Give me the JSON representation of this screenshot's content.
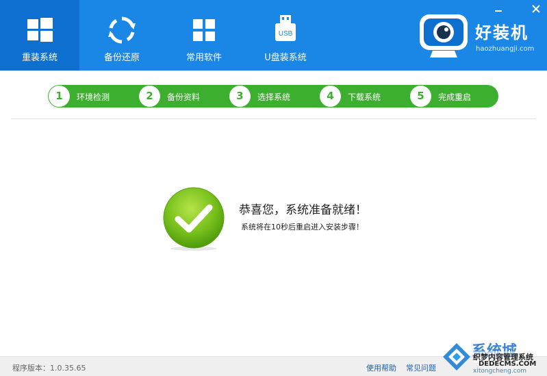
{
  "header": {
    "nav": [
      {
        "label": "重装系统",
        "icon": "windows-icon",
        "active": true
      },
      {
        "label": "备份还原",
        "icon": "sync-icon",
        "active": false
      },
      {
        "label": "常用软件",
        "icon": "apps-grid-icon",
        "active": false
      },
      {
        "label": "U盘装系统",
        "icon": "usb-drive-icon",
        "active": false
      }
    ],
    "logo_text": "好装机",
    "logo_url": "haozhuangji.com",
    "usb_badge": "USB"
  },
  "steps": [
    {
      "num": "1",
      "label": "环境检测"
    },
    {
      "num": "2",
      "label": "备份资料"
    },
    {
      "num": "3",
      "label": "选择系统"
    },
    {
      "num": "4",
      "label": "下载系统"
    },
    {
      "num": "5",
      "label": "完成重启"
    }
  ],
  "main": {
    "title": "恭喜您，系统准备就绪！",
    "subtitle": "系统将在10秒后重启进入安装步骤！"
  },
  "footer": {
    "version_label": "程序版本：",
    "version": "1.0.35.65",
    "help": "使用帮助",
    "faq": "常见问题"
  },
  "watermark": {
    "line1": "系统城",
    "line2": "织梦内容管理系统",
    "line3": "DEDECMS.COM",
    "line4": "xitongcheng.com"
  },
  "colors": {
    "header_blue": "#1a86e6",
    "active_tab": "#0d6fd0",
    "step_green": "#3cb02e",
    "link_blue": "#1f5fae"
  }
}
